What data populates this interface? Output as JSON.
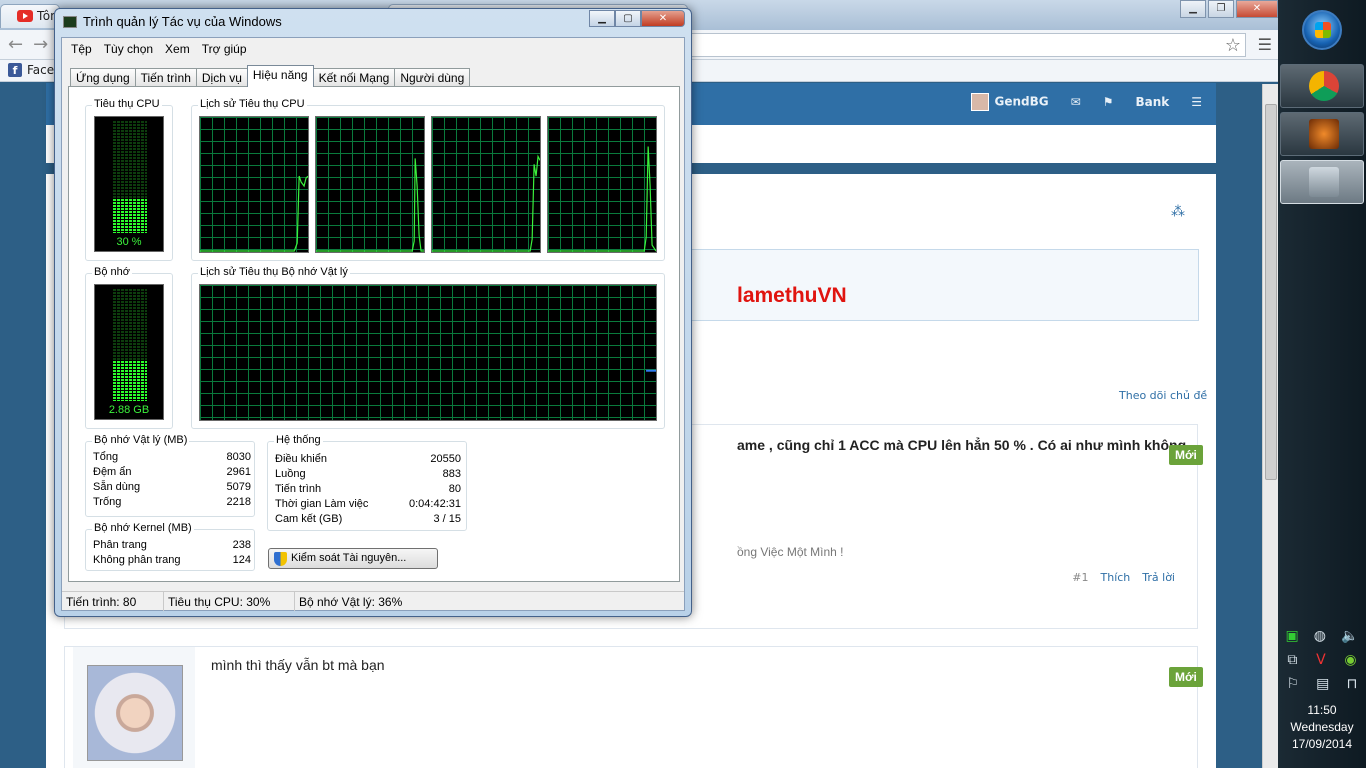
{
  "browser": {
    "tab1_label": "Tôn",
    "tab2_label": "",
    "bookmark_label": "Facel",
    "window_controls": {
      "minimize": "▁",
      "restore": "❐",
      "close": "✕"
    }
  },
  "forum": {
    "nav": {
      "user": "GendBG",
      "bank": "Bank"
    },
    "page_title": "lamethuVN",
    "follow": "Theo dõi chủ đề",
    "post1": {
      "text": "ame , cũng chỉ 1 ACC mà CPU lên hẳn 50 % . Có ai như mình không",
      "badge": "Mới",
      "signature": "ồng Việc Một Mình !",
      "num": "#1",
      "like": "Thích",
      "reply": "Trả lời"
    },
    "post2": {
      "text": "mình thì thấy vẫn bt mà bạn",
      "badge": "Mới"
    }
  },
  "taskbar": {
    "time": "11:50",
    "day": "Wednesday",
    "date": "17/09/2014"
  },
  "taskmanager": {
    "title": "Trình quản lý Tác vụ của Windows",
    "menu": [
      "Tệp",
      "Tùy chọn",
      "Xem",
      "Trợ giúp"
    ],
    "tabs": [
      "Ứng dụng",
      "Tiến trình",
      "Dịch vụ",
      "Hiệu năng",
      "Kết nối Mạng",
      "Người dùng"
    ],
    "selected_tab": "Hiệu năng",
    "cpu_usage_label": "Tiêu thụ CPU",
    "cpu_history_label": "Lịch sử Tiêu thụ CPU",
    "mem_label": "Bộ nhớ",
    "mem_history_label": "Lịch sử Tiêu thụ Bộ nhớ Vật lý",
    "cpu_percent_text": "30 %",
    "cpu_percent": 0.3,
    "mem_text": "2.88 GB",
    "mem_fraction": 0.36,
    "physical": {
      "title": "Bộ nhớ Vật lý (MB)",
      "rows": [
        [
          "Tổng",
          "8030"
        ],
        [
          "Đệm ẩn",
          "2961"
        ],
        [
          "Sẵn dùng",
          "5079"
        ],
        [
          "Trống",
          "2218"
        ]
      ]
    },
    "kernel": {
      "title": "Bộ nhớ Kernel (MB)",
      "rows": [
        [
          "Phân trang",
          "238"
        ],
        [
          "Không phân trang",
          "124"
        ]
      ]
    },
    "system": {
      "title": "Hệ thống",
      "rows": [
        [
          "Điều khiển",
          "20550"
        ],
        [
          "Luồng",
          "883"
        ],
        [
          "Tiến trình",
          "80"
        ],
        [
          "Thời gian Làm việc",
          "0:04:42:31"
        ],
        [
          "Cam kết (GB)",
          "3 / 15"
        ]
      ]
    },
    "resource_button": "Kiểm soát Tài nguyên...",
    "status": {
      "processes": "Tiến trình: 80",
      "cpu": "Tiêu thụ CPU: 30%",
      "memory": "Bộ nhớ Vật lý: 36%"
    },
    "controls": {
      "minimize": "▁",
      "maximize": "▢",
      "close": "✕"
    }
  }
}
